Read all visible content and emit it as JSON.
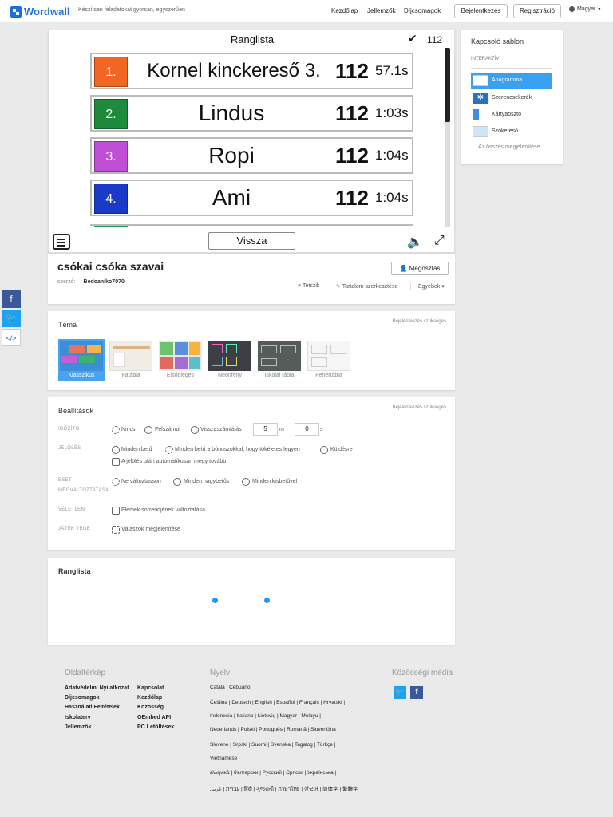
{
  "header": {
    "logo": "Wordwall",
    "tagline": "Készítsen feladatokat gyorsan, egyszerűen",
    "nav": [
      "Kezdőlap",
      "Jellemzők",
      "Díjcsomagok"
    ],
    "login": "Bejelentkezés",
    "register": "Regisztráció",
    "language": "Magyar"
  },
  "game": {
    "title": "Ranglista",
    "score": "112",
    "rows": [
      {
        "rank": "1.",
        "name": "Kornel kinckereső 3.",
        "score": "112",
        "time": "57.1s",
        "color": "#f26522"
      },
      {
        "rank": "2.",
        "name": "Lindus",
        "score": "112",
        "time": "1:03s",
        "color": "#1e8a3c"
      },
      {
        "rank": "3.",
        "name": "Ropi",
        "score": "112",
        "time": "1:04s",
        "color": "#c04ed6"
      },
      {
        "rank": "4.",
        "name": "Ami",
        "score": "112",
        "time": "1:04s",
        "color": "#1a3ac8"
      }
    ],
    "back": "Vissza"
  },
  "activity": {
    "title": "csókai csóka szavai",
    "author_label": "szerző:",
    "author": "Bedoaniko7070",
    "share": "Megosztás",
    "like": "Tetszik",
    "edit": "Tartalom szerkesztése",
    "more": "Egyebek"
  },
  "theme": {
    "title": "Téma",
    "login_required": "Bejelentkezés szükséges",
    "items": [
      "Klasszikus",
      "Fatábla",
      "Elsődleges",
      "Neonfény",
      "Iskolai tábla",
      "Fehértábla"
    ]
  },
  "settings": {
    "title": "Beállítások",
    "login_required": "Bejelentkezés szükséges",
    "timer_label": "IDŐZÍTŐ",
    "timer_opts": [
      "Nincs",
      "Felszámol",
      "Visszaszámlálás"
    ],
    "minutes": "5",
    "minutes_unit": "m",
    "seconds": "0",
    "seconds_unit": "s",
    "marking_label": "JELÖLÉS",
    "marking_opts": [
      "Minden betű",
      "Minden betű a bónuszokkal, hogy tökéletes legyen",
      "Küldésre"
    ],
    "marking_check": "A jelölés után automatikusan megy tovább",
    "case_label_1": "ESET",
    "case_label_2": "MEGVÁLTOZTATÁSA",
    "case_opts": [
      "Ne változtasson",
      "Minden nagybetűs",
      "Minden kisbetűvel"
    ],
    "random_label": "VÉLETLEN",
    "random_opt": "Elemek sorrendjének változtatása",
    "end_label": "JÁTÉK VÉGE",
    "end_opt": "Válaszok megjelenítése"
  },
  "leaderboard": {
    "title": "Ranglista"
  },
  "sidebar": {
    "title": "Kapcsoló sablon",
    "subtitle": "INTERAKTÍV",
    "items": [
      "Anagramma",
      "Szerencsekerék",
      "Kártyaosztó",
      "Szókereső"
    ],
    "all": "Az összes megjelenítése"
  },
  "footer": {
    "sitemap_title": "Oldaltérkép",
    "col1": [
      "Adatvédelmi Nyilatkozat",
      "Díjcsomagok",
      "Használati Feltételek",
      "Iskolaterv",
      "Jellemzők"
    ],
    "col2": [
      "Kapcsolat",
      "Kezdőlap",
      "Közösség",
      "OEmbed API",
      "PC Letöltések"
    ],
    "language_title": "Nyelv",
    "languages": [
      "Català  |  Cebuano",
      "Čeština  |  Deutsch  |  English  |  Español  |  Français  |  Hrvatski  |",
      "Indonesia  |  Italiano  |  Lietuvių  |  Magyar  |  Melayu  |",
      "Nederlands  |  Polski  |  Português  |  Română  |  Slovenčina  |",
      "Slovene  |  Srpski  |  Suomi  |  Svenska  |  Tagalog  |  Türkçe  |",
      "Vietnamese",
      "ελληνικά  |  български  |  Русский  |  Српски  |  Українська  |",
      "עִברִית  |  عربى  |  हिंदी  |  ગુજરાતી  |  ภาษาไทย  |  한국어  |  简体字  |  繁體字"
    ],
    "social_title": "Közösségi média"
  }
}
